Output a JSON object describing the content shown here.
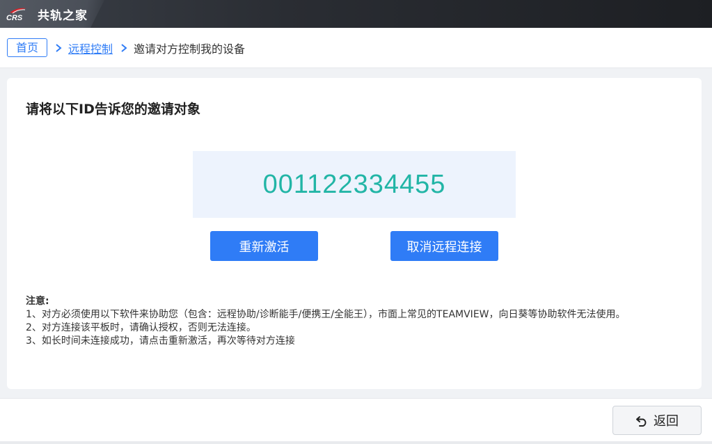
{
  "app": {
    "brand_mark": "CRS",
    "brand_name": "共轨之家"
  },
  "breadcrumb": {
    "home": "首页",
    "separator": ">",
    "level1": "远程控制",
    "current": "邀请对方控制我的设备"
  },
  "main": {
    "title": "请将以下ID告诉您的邀请对象",
    "device_id": "001122334455",
    "reactivate_label": "重新激活",
    "cancel_label": "取消远程连接"
  },
  "notes": {
    "title": "注意:",
    "lines": [
      "1、对方必须使用以下软件来协助您（包含：远程协助/诊断能手/便携王/全能王），市面上常见的TEAMVIEW，向日葵等协助软件无法使用。",
      "2、对方连接该平板时，请确认授权，否则无法连接。",
      "3、如长时间未连接成功，请点击重新激活，再次等待对方连接"
    ]
  },
  "footer": {
    "back_label": "返回"
  },
  "colors": {
    "accent": "#2f7cf6",
    "id_text": "#22b5a6",
    "id_box_bg": "#edf3fd",
    "page_bg": "#f0f2f5",
    "topbar": "#2a2d33"
  },
  "icons": {
    "back": "undo-arrow-icon",
    "breadcrumb_separator": "chevron-right-icon"
  }
}
